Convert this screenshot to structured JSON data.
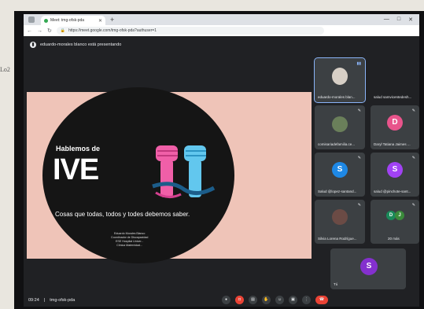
{
  "paper_note": "Lo2",
  "browser": {
    "tab_title": "Meet: tmg-ofsk-pda",
    "url": "https://meet.google.com/tmg-ofsk-pda?authuser=1",
    "new_tab": "+",
    "win_controls": [
      "—",
      "□",
      "✕"
    ]
  },
  "banner": {
    "text": "eduardo-morales blanco está presentando"
  },
  "slide": {
    "title_small": "Hablemos de",
    "title_big": "IVE",
    "subtitle": "Cosas que todas, todos y todes debemos saber.",
    "credits": [
      "Eduardo Morales Blanco",
      "Coordinador de Discapacidad",
      "ESE Hospital Univer...",
      "Clínica Maternidad..."
    ]
  },
  "participants": [
    {
      "name": "eduardo-morales blan...",
      "type": "photo"
    },
    {
      "name": "salud samvicentedesh...",
      "type": "none"
    },
    {
      "name": "comisariadefamilia.ce...",
      "type": "photo"
    },
    {
      "name": "Daryl Tatiana Jaimes ...",
      "type": "letter",
      "letter": "D",
      "color": "#e8548b"
    },
    {
      "name": "Salud @lopez-santand...",
      "type": "letter",
      "letter": "S",
      "color": "#1e88e5"
    },
    {
      "name": "salud @pinchote-sant...",
      "type": "letter",
      "letter": "S",
      "color": "#a142f4"
    },
    {
      "name": "Silvia Lorena Rodrígue...",
      "type": "photo"
    },
    {
      "name": "20 más",
      "type": "group",
      "letters": [
        "D",
        "J"
      ]
    },
    {
      "name": "Tú",
      "type": "letter",
      "letter": "S",
      "color": "#8430ce"
    }
  ],
  "bottom": {
    "time": "09:24",
    "separator": "|",
    "meeting_code": "tmg-ofsk-pda"
  },
  "controls": [
    "mic",
    "camera",
    "captions",
    "raise-hand",
    "present",
    "more",
    "end-call"
  ]
}
